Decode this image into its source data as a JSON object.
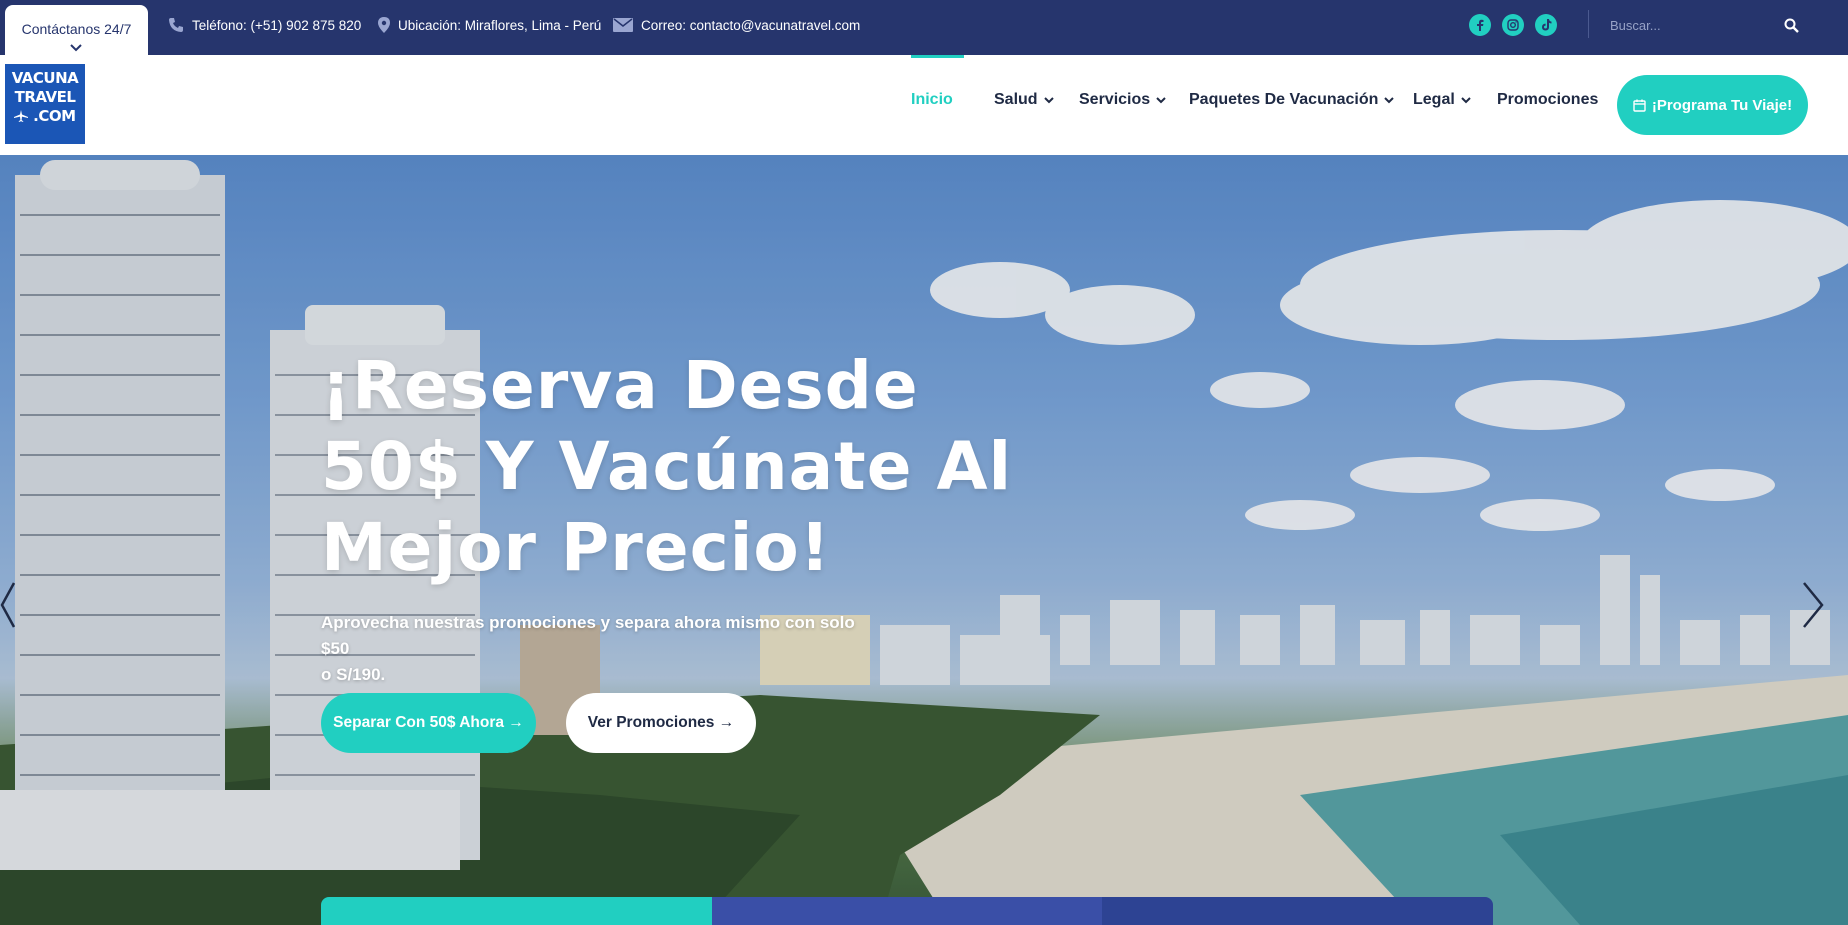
{
  "topbar": {
    "contact_tab": "Contáctanos 24/7",
    "phone": "Teléfono: (+51) 902 875 820",
    "location": "Ubicación: Miraflores, Lima - Perú",
    "email": "Correo: contacto@vacunatravel.com",
    "social": [
      "facebook-icon",
      "instagram-icon",
      "tiktok-icon"
    ],
    "search_placeholder": "Buscar..."
  },
  "logo": {
    "line1": "VACUNA",
    "line2": "TRAVEL",
    "line3": ".COM"
  },
  "nav": {
    "items": [
      {
        "label": "Inicio",
        "active": true,
        "dropdown": false
      },
      {
        "label": "Salud",
        "active": false,
        "dropdown": true
      },
      {
        "label": "Servicios",
        "active": false,
        "dropdown": true
      },
      {
        "label": "Paquetes De Vacunación",
        "active": false,
        "dropdown": true
      },
      {
        "label": "Legal",
        "active": false,
        "dropdown": true
      },
      {
        "label": "Promociones",
        "active": false,
        "dropdown": false
      }
    ],
    "cta": "¡Programa Tu Viaje!"
  },
  "hero": {
    "title_line1": "¡Reserva Desde",
    "title_line2": "50$ Y Vacúnate Al",
    "title_line3": "Mejor Precio!",
    "subtitle_line1": "Aprovecha nuestras promociones y separa ahora mismo con solo $50",
    "subtitle_line2": "o S/190.",
    "primary_button": "Separar Con 50$ Ahora →",
    "secondary_button": "Ver Promociones →"
  },
  "colors": {
    "navy": "#26356d",
    "accent": "#21cfc1",
    "logo_blue": "#1b56b6",
    "tab_blue_1": "#3a4fa7",
    "tab_blue_2": "#2d4393"
  }
}
